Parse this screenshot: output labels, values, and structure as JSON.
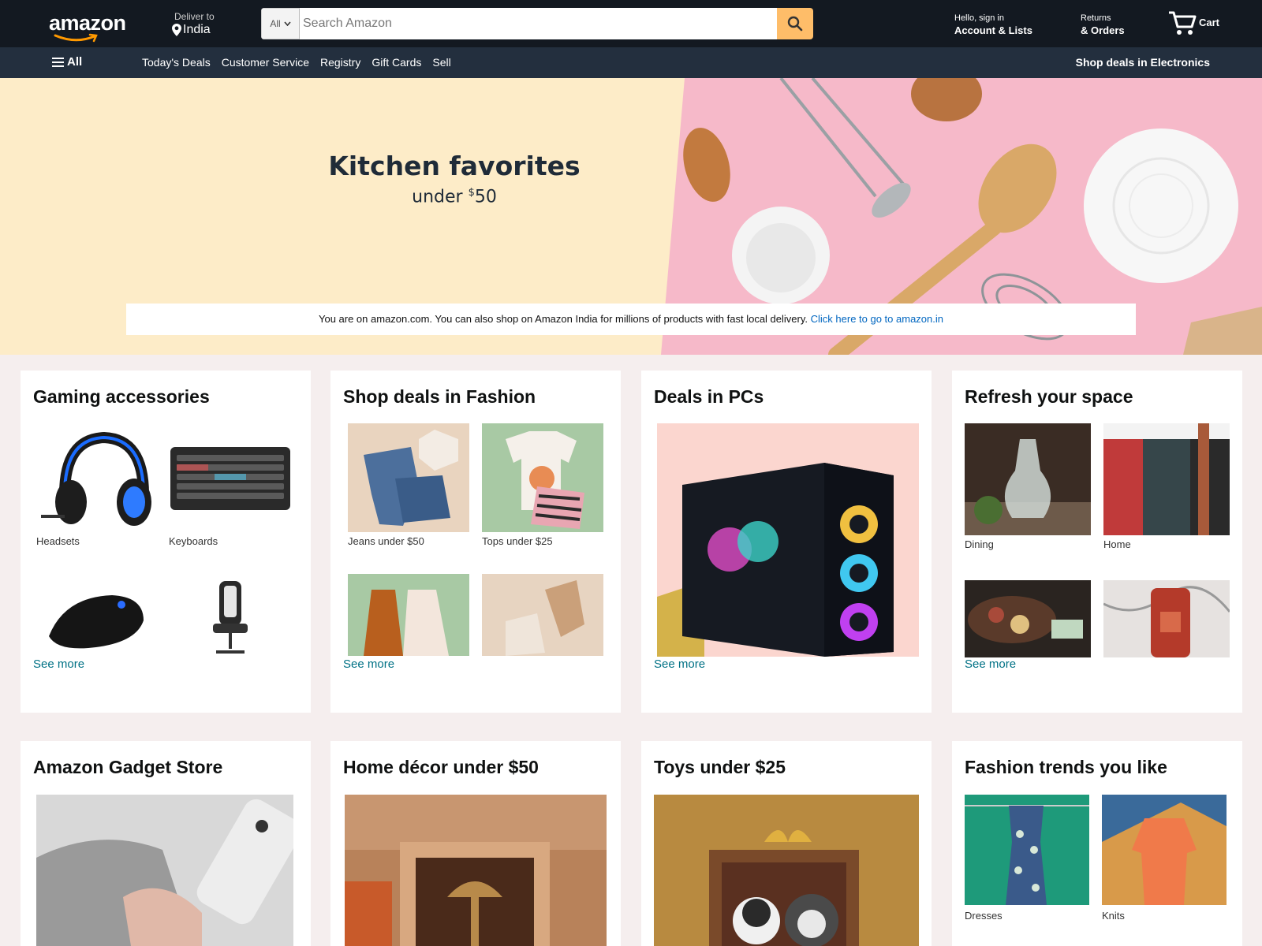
{
  "header": {
    "logo_text": "amazon",
    "deliver_label": "Deliver to",
    "deliver_location": "India",
    "search_category": "All",
    "search_placeholder": "Search Amazon",
    "account_greeting": "Hello, sign in",
    "account_label": "Account & Lists",
    "returns_label": "Returns",
    "orders_label": "& Orders",
    "cart_label": "Cart"
  },
  "subnav": {
    "all_label": "All",
    "links": [
      "Today's Deals",
      "Customer Service",
      "Registry",
      "Gift Cards",
      "Sell"
    ],
    "promo": "Shop deals in Electronics"
  },
  "hero": {
    "title": "Kitchen favorites",
    "subtitle_prefix": "under ",
    "subtitle_currency": "$",
    "subtitle_amount": "50",
    "notice_text": "You are on amazon.com. You can also shop on Amazon India for millions of products with fast local delivery. ",
    "notice_link": "Click here to go to amazon.in"
  },
  "cards_row1": [
    {
      "title": "Gaming accessories",
      "items": [
        "Headsets",
        "Keyboards",
        "",
        ""
      ],
      "see_more": "See more"
    },
    {
      "title": "Shop deals in Fashion",
      "items": [
        "Jeans under $50",
        "Tops under $25",
        "",
        ""
      ],
      "see_more": "See more"
    },
    {
      "title": "Deals in PCs",
      "see_more": "See more"
    },
    {
      "title": "Refresh your space",
      "items": [
        "Dining",
        "Home",
        "",
        ""
      ],
      "see_more": "See more"
    }
  ],
  "cards_row2": [
    {
      "title": "Amazon Gadget Store"
    },
    {
      "title": "Home décor under $50"
    },
    {
      "title": "Toys under $25"
    },
    {
      "title": "Fashion trends you like",
      "items": [
        "Dresses",
        "Knits"
      ]
    }
  ],
  "colors": {
    "nav_bg": "#131921",
    "subnav_bg": "#232f3e",
    "search_button": "#febd69",
    "link": "#007185",
    "hero_bg": "#fdecc8",
    "hero_pink": "#f6b9c9",
    "page_bg": "#f5eeee"
  }
}
